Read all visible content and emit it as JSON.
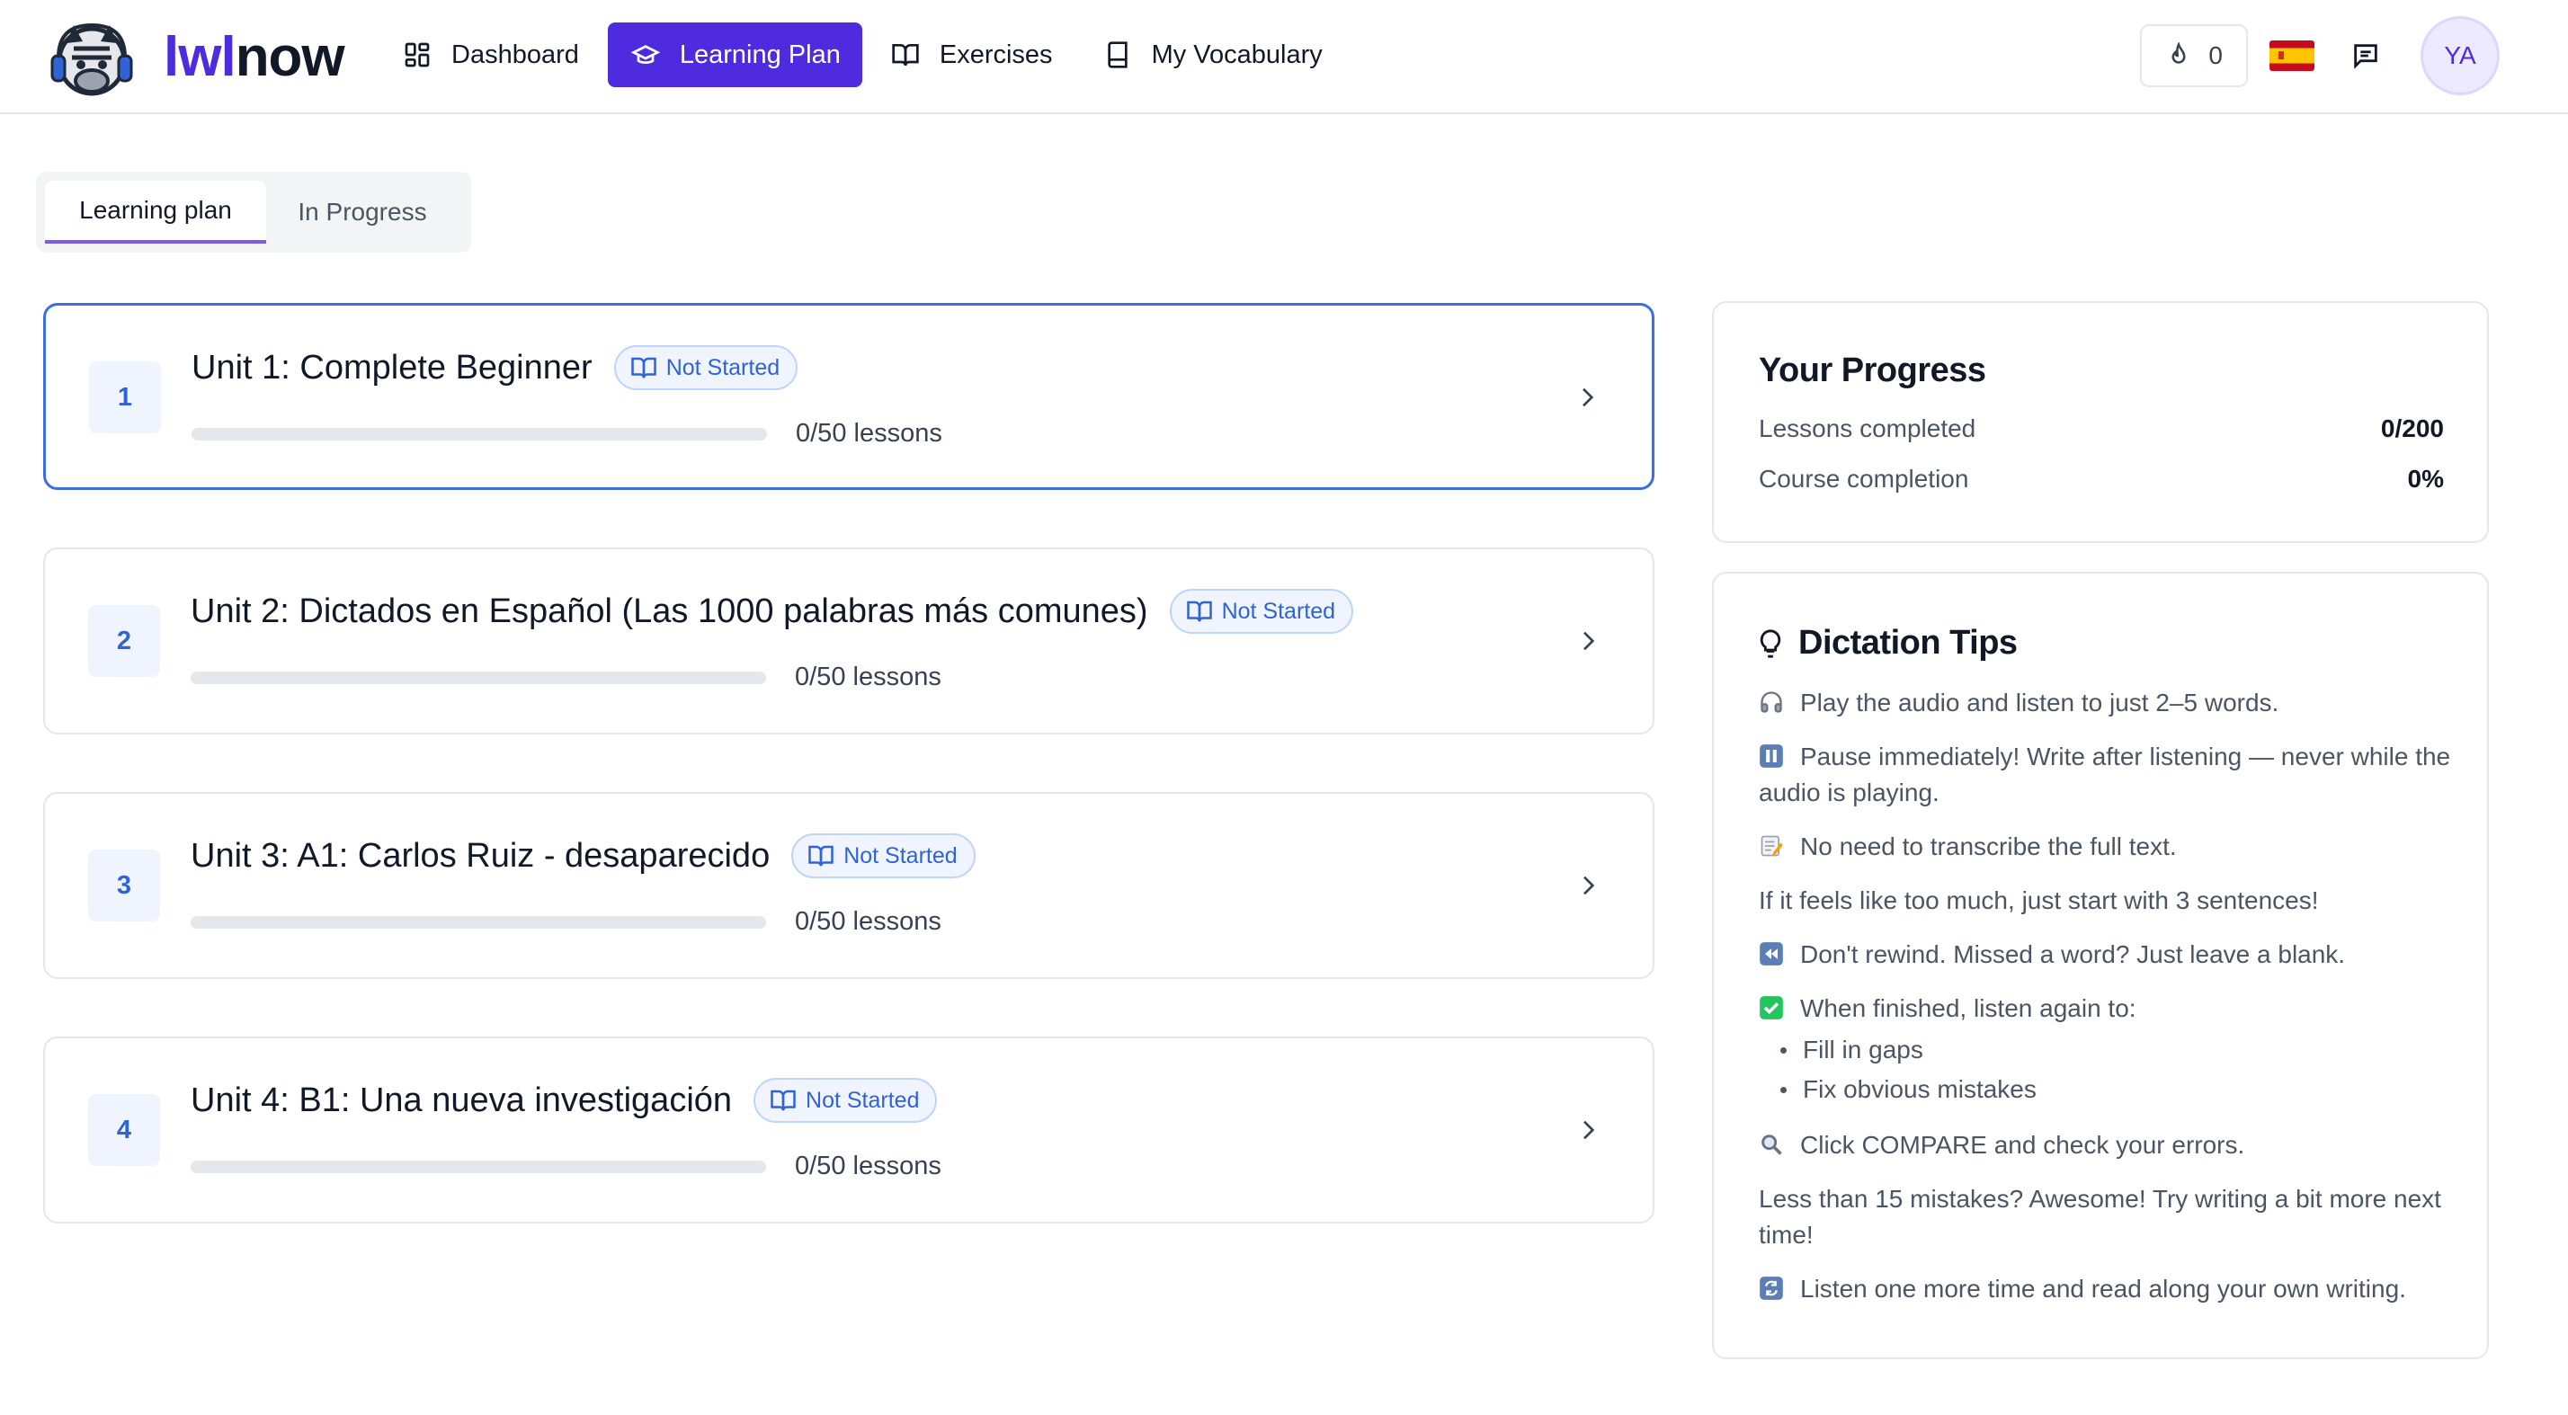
{
  "header": {
    "logo": {
      "part1": "lwl",
      "part2": "now"
    },
    "nav": [
      {
        "label": "Dashboard",
        "icon": "dashboard-icon"
      },
      {
        "label": "Learning Plan",
        "icon": "graduation-cap-icon",
        "active": true
      },
      {
        "label": "Exercises",
        "icon": "open-book-icon"
      },
      {
        "label": "My Vocabulary",
        "icon": "book-icon"
      }
    ],
    "streak": "0",
    "language_flag": "spain-flag-icon",
    "avatar_initials": "YA"
  },
  "tabs": [
    {
      "label": "Learning plan",
      "active": true
    },
    {
      "label": "In Progress",
      "active": false
    }
  ],
  "units": [
    {
      "number": "1",
      "title": "Unit 1: Complete Beginner",
      "status": "Not Started",
      "lessons": "0/50 lessons",
      "progress": 0,
      "selected": true
    },
    {
      "number": "2",
      "title": "Unit 2: Dictados en Español (Las 1000 palabras más comunes)",
      "status": "Not Started",
      "lessons": "0/50 lessons",
      "progress": 0
    },
    {
      "number": "3",
      "title": "Unit 3: A1: Carlos Ruiz - desaparecido",
      "status": "Not Started",
      "lessons": "0/50 lessons",
      "progress": 0
    },
    {
      "number": "4",
      "title": "Unit 4: B1: Una nueva investigación",
      "status": "Not Started",
      "lessons": "0/50 lessons",
      "progress": 0
    }
  ],
  "progress_card": {
    "title": "Your Progress",
    "lessons_label": "Lessons completed",
    "lessons_value": "0/200",
    "completion_label": "Course completion",
    "completion_value": "0%"
  },
  "tips_card": {
    "title": "Dictation Tips",
    "tips": {
      "t1": "Play the audio and listen to just 2–5 words.",
      "t2": "Pause immediately! Write after listening — never while the audio is playing.",
      "t3": "No need to transcribe the full text.",
      "t4": "If it feels like too much, just start with 3 sentences!",
      "t5": "Don't rewind. Missed a word? Just leave a blank.",
      "t6": "When finished, listen again to:",
      "t6a": "Fill in gaps",
      "t6b": "Fix obvious mistakes",
      "t7": "Click COMPARE and check your errors.",
      "t8": "Less than 15 mistakes? Awesome! Try writing a bit more next time!",
      "t9": "Listen one more time and read along your own writing."
    }
  },
  "colors": {
    "brand": "#4f2be0",
    "selected_border": "#3b6ee0",
    "badge_blue": "#2f63d6"
  }
}
